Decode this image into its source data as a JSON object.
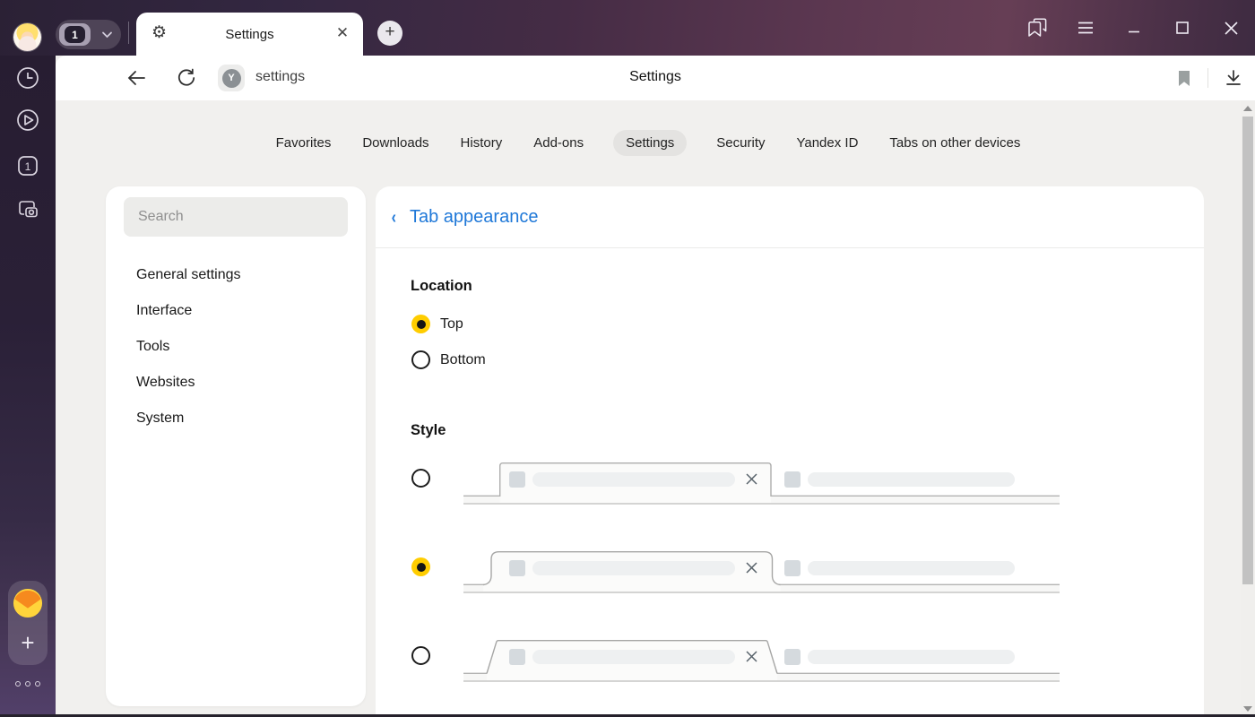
{
  "chrome": {
    "tab_group_count": "1",
    "tab_title": "Settings",
    "new_tab_label": "+",
    "site_icon_letter": "Y",
    "url": "settings",
    "page_title": "Settings"
  },
  "topnav": {
    "items": [
      {
        "label": "Favorites",
        "active": false
      },
      {
        "label": "Downloads",
        "active": false
      },
      {
        "label": "History",
        "active": false
      },
      {
        "label": "Add-ons",
        "active": false
      },
      {
        "label": "Settings",
        "active": true
      },
      {
        "label": "Security",
        "active": false
      },
      {
        "label": "Yandex ID",
        "active": false
      },
      {
        "label": "Tabs on other devices",
        "active": false
      }
    ]
  },
  "settings_sidebar": {
    "search_placeholder": "Search",
    "items": [
      {
        "label": "General settings"
      },
      {
        "label": "Interface"
      },
      {
        "label": "Tools"
      },
      {
        "label": "Websites"
      },
      {
        "label": "System"
      }
    ]
  },
  "panel": {
    "back_chevron": "‹",
    "title": "Tab appearance",
    "location": {
      "heading": "Location",
      "options": [
        {
          "label": "Top",
          "selected": true
        },
        {
          "label": "Bottom",
          "selected": false
        }
      ]
    },
    "style": {
      "heading": "Style",
      "options": [
        {
          "name": "square",
          "selected": false
        },
        {
          "name": "rounded",
          "selected": true
        },
        {
          "name": "slanted",
          "selected": false
        }
      ]
    }
  },
  "sidebar_rail": {
    "tab_count_badge": "1"
  },
  "colors": {
    "accent_blue": "#1f78d8",
    "radio_yellow": "#ffcd00",
    "active_nav_pill": "#e4e3e1",
    "chrome_dark": "#33263f"
  }
}
